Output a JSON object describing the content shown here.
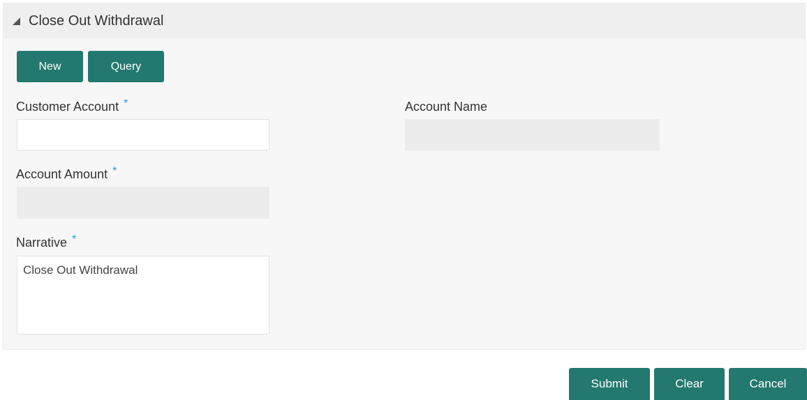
{
  "panel": {
    "title": "Close Out Withdrawal",
    "icon": "collapse-triangle-icon"
  },
  "toolbar": {
    "new_label": "New",
    "query_label": "Query"
  },
  "form": {
    "customer_account": {
      "label": "Customer Account",
      "required_mark": "*",
      "value": ""
    },
    "account_name": {
      "label": "Account Name",
      "value": ""
    },
    "account_amount": {
      "label": "Account Amount",
      "required_mark": "*",
      "value": ""
    },
    "narrative": {
      "label": "Narrative",
      "required_mark": "*",
      "value": "Close Out Withdrawal"
    }
  },
  "actions": {
    "submit_label": "Submit",
    "clear_label": "Clear",
    "cancel_label": "Cancel"
  },
  "colors": {
    "accent": "#23786f",
    "required": "#1f96d3",
    "panel_bg": "#f7f7f7",
    "readonly_bg": "#ececec"
  }
}
